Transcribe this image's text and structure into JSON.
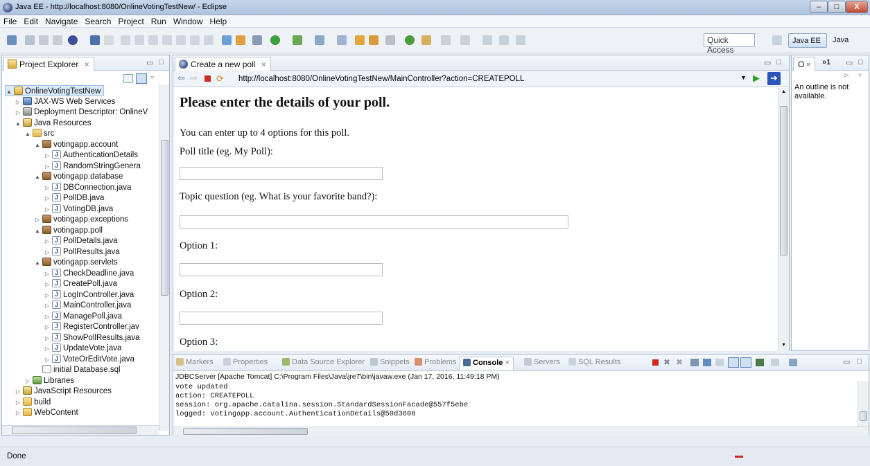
{
  "window": {
    "title": "Java EE - http://localhost:8080/OnlineVotingTestNew/ - Eclipse",
    "minimize_label": "–",
    "maximize_label": "□",
    "close_label": "X"
  },
  "menu": [
    "File",
    "Edit",
    "Navigate",
    "Search",
    "Project",
    "Run",
    "Window",
    "Help"
  ],
  "toolbar": {
    "quick_access_placeholder": "Quick Access",
    "perspectives": [
      "Java EE",
      "Java"
    ]
  },
  "explorer": {
    "tab_label": "Project Explorer",
    "items": [
      {
        "label": "OnlineVotingTestNew",
        "icon": "project-icon"
      },
      {
        "label": "JAX-WS Web Services",
        "icon": "webservices-icon"
      },
      {
        "label": "Deployment Descriptor: OnlineV",
        "icon": "descriptor-icon"
      },
      {
        "label": "Java Resources",
        "icon": "java-resources-icon"
      },
      {
        "label": "src",
        "icon": "source-folder-icon"
      },
      {
        "label": "votingapp.account",
        "icon": "package-icon"
      },
      {
        "label": "AuthenticationDetails",
        "icon": "java-file-icon"
      },
      {
        "label": "RandomStringGenera",
        "icon": "java-file-icon"
      },
      {
        "label": "votingapp.database",
        "icon": "package-icon"
      },
      {
        "label": "DBConnection.java",
        "icon": "java-file-icon"
      },
      {
        "label": "PollDB.java",
        "icon": "java-file-icon"
      },
      {
        "label": "VotingDB.java",
        "icon": "java-file-icon"
      },
      {
        "label": "votingapp.exceptions",
        "icon": "package-icon"
      },
      {
        "label": "votingapp.poll",
        "icon": "package-icon"
      },
      {
        "label": "PollDetails.java",
        "icon": "java-file-icon"
      },
      {
        "label": "PollResults.java",
        "icon": "java-file-icon"
      },
      {
        "label": "votingapp.servlets",
        "icon": "package-icon"
      },
      {
        "label": "CheckDeadline.java",
        "icon": "java-file-icon"
      },
      {
        "label": "CreatePoll.java",
        "icon": "java-file-icon"
      },
      {
        "label": "LogInController.java",
        "icon": "java-file-icon"
      },
      {
        "label": "MainController.java",
        "icon": "java-file-icon"
      },
      {
        "label": "ManagePoll.java",
        "icon": "java-file-icon"
      },
      {
        "label": "RegisterController.jav",
        "icon": "java-file-icon"
      },
      {
        "label": "ShowPollResults.java",
        "icon": "java-file-icon"
      },
      {
        "label": "UpdateVote.java",
        "icon": "java-file-icon"
      },
      {
        "label": "VoteOrEditVote.java",
        "icon": "java-file-icon"
      },
      {
        "label": "initial Database.sql",
        "icon": "sql-file-icon"
      },
      {
        "label": "Libraries",
        "icon": "libraries-icon"
      },
      {
        "label": "JavaScript Resources",
        "icon": "javascript-resources-icon"
      },
      {
        "label": "build",
        "icon": "folder-icon"
      },
      {
        "label": "WebContent",
        "icon": "folder-icon"
      }
    ]
  },
  "browser": {
    "tab_label": "Create a new poll",
    "url": "http://localhost:8080/OnlineVotingTestNew/MainController?action=CREATEPOLL",
    "page": {
      "heading": "Please enter the details of your poll.",
      "intro": "You can enter up to 4 options for this poll.",
      "poll_title_label": "Poll title (eg. My Poll):",
      "topic_label": "Topic question (eg. What is your favorite band?):",
      "option1_label": "Option 1:",
      "option2_label": "Option 2:",
      "option3_label": "Option 3:"
    }
  },
  "outline": {
    "tab_label": "O",
    "more_label": "»1",
    "message": "An outline is not available."
  },
  "console": {
    "tabs": [
      "Markers",
      "Properties",
      "Data Source Explorer",
      "Snippets",
      "Problems",
      "Console",
      "Servers",
      "SQL Results"
    ],
    "active_tab": "Console",
    "header": "JDBCServer [Apache Tomcat] C:\\Program Files\\Java\\jre7\\bin\\javaw.exe (Jan 17, 2016, 11:49:18 PM)",
    "lines": [
      "vote updated",
      "action: CREATEPOLL",
      "session: org.apache.catalina.session.StandardSessionFacade@557f5ebe",
      "logged: votingapp.account.AuthenticationDetails@50d3608"
    ]
  },
  "status": {
    "text": "Done"
  },
  "colors": {
    "accent": "#3a6ea5",
    "title_bar": "#b7cbe3",
    "close_button": "#c4482f"
  }
}
